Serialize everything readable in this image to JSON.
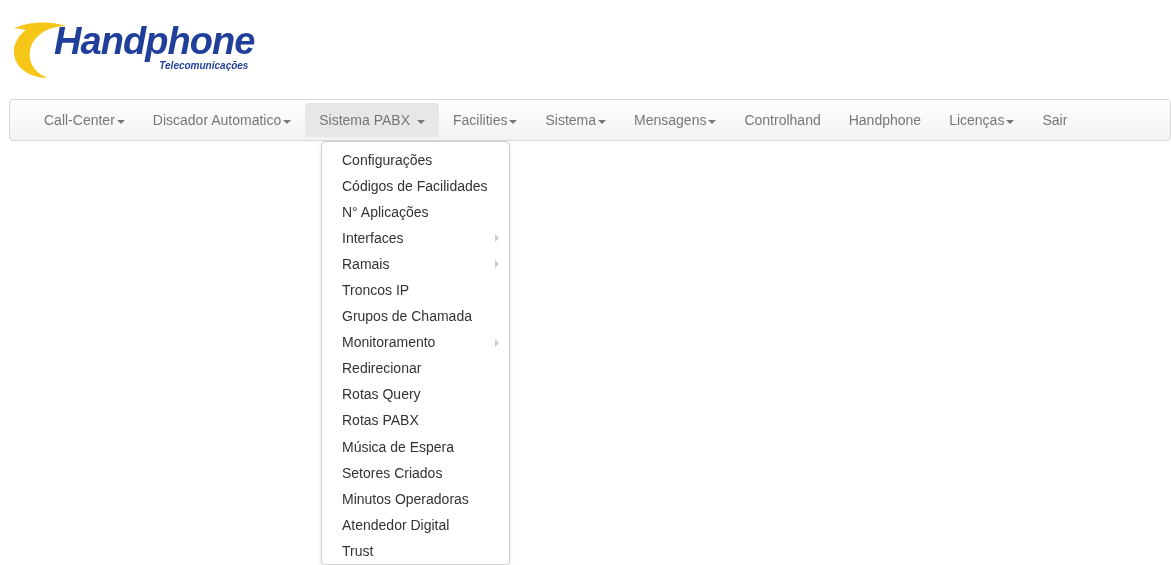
{
  "logo": {
    "name": "Handphone",
    "tagline": "Telecomunicações"
  },
  "nav": [
    {
      "label": "Call-Center",
      "dropdown": true,
      "selected": false
    },
    {
      "label": "Discador Automatico",
      "dropdown": true,
      "selected": false
    },
    {
      "label": "Sistema PABX",
      "dropdown": true,
      "selected": true
    },
    {
      "label": "Facilities",
      "dropdown": true,
      "selected": false
    },
    {
      "label": "Sistema",
      "dropdown": true,
      "selected": false
    },
    {
      "label": "Mensagens",
      "dropdown": true,
      "selected": false
    },
    {
      "label": "Controlhand",
      "dropdown": false,
      "selected": false
    },
    {
      "label": "Handphone",
      "dropdown": false,
      "selected": false
    },
    {
      "label": "Licenças",
      "dropdown": true,
      "selected": false
    },
    {
      "label": "Sair",
      "dropdown": false,
      "selected": false
    }
  ],
  "menu": [
    {
      "label": "Configurações",
      "submenu": false
    },
    {
      "label": "Códigos de Facilidades",
      "submenu": false
    },
    {
      "label": "N° Aplicações",
      "submenu": false
    },
    {
      "label": "Interfaces",
      "submenu": true
    },
    {
      "label": "Ramais",
      "submenu": true
    },
    {
      "label": "Troncos IP",
      "submenu": false
    },
    {
      "label": "Grupos de Chamada",
      "submenu": false
    },
    {
      "label": "Monitoramento",
      "submenu": true
    },
    {
      "label": "Redirecionar",
      "submenu": false
    },
    {
      "label": "Rotas Query",
      "submenu": false
    },
    {
      "label": "Rotas PABX",
      "submenu": false
    },
    {
      "label": "Música de Espera",
      "submenu": false
    },
    {
      "label": "Setores Criados",
      "submenu": false
    },
    {
      "label": "Minutos Operadoras",
      "submenu": false
    },
    {
      "label": "Atendedor Digital",
      "submenu": false
    },
    {
      "label": "Trust",
      "submenu": false
    }
  ]
}
